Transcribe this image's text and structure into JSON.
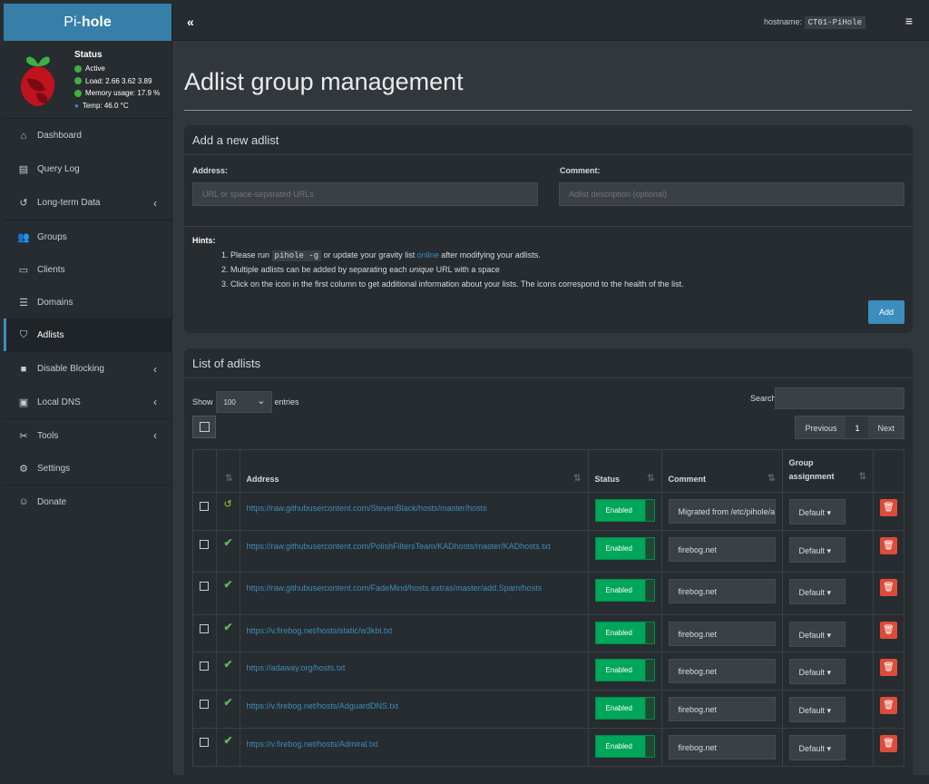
{
  "brand": {
    "prefix": "Pi-",
    "name": "hole"
  },
  "status": {
    "title": "Status",
    "active": "Active",
    "load": "Load:  2.66  3.62  3.89",
    "memory": "Memory usage:  17.9 %",
    "temp": "Temp: 46.0 °C"
  },
  "nav": [
    {
      "label": "Dashboard",
      "icon": "home-icon"
    },
    {
      "label": "Query Log",
      "icon": "file-icon"
    },
    {
      "label": "Long-term Data",
      "icon": "history-icon"
    },
    {
      "label": "Groups",
      "icon": "users-icon"
    },
    {
      "label": "Clients",
      "icon": "laptop-icon"
    },
    {
      "label": "Domains",
      "icon": "list-icon"
    },
    {
      "label": "Adlists",
      "icon": "shield-icon"
    },
    {
      "label": "Disable Blocking",
      "icon": "stop-icon"
    },
    {
      "label": "Local DNS",
      "icon": "address-book-icon"
    },
    {
      "label": "Tools",
      "icon": "tools-icon"
    },
    {
      "label": "Settings",
      "icon": "gear-icon"
    },
    {
      "label": "Donate",
      "icon": "donate-icon"
    }
  ],
  "header": {
    "collapse": "«",
    "hostname_label": "hostname:",
    "hostname": "CT01-PiHole",
    "menu": "≡"
  },
  "page": {
    "title": "Adlist group management"
  },
  "add_box": {
    "title": "Add a new adlist",
    "address_label": "Address:",
    "address_placeholder": "URL or space-separated URLs",
    "comment_label": "Comment:",
    "comment_placeholder": "Adlist description (optional)",
    "hints_label": "Hints:",
    "hint1_pre": "1. Please run ",
    "hint1_code": "pihole -g",
    "hint1_mid": " or update your gravity list ",
    "hint1_link": "online",
    "hint1_post": " after modifying your adlists.",
    "hint2_pre": "2. Multiple adlists can be added by separating each ",
    "hint2_em": "unique",
    "hint2_post": " URL with a space",
    "hint3": "3. Click on the icon in the first column to get additional information about your lists. The icons correspond to the health of the list.",
    "add_button": "Add"
  },
  "list_box": {
    "title": "List of adlists",
    "show": "Show",
    "entries_value": "100",
    "entries": "entries",
    "search": "Search:",
    "prev": "Previous",
    "page": "1",
    "next": "Next",
    "columns": {
      "address": "Address",
      "status": "Status",
      "comment": "Comment",
      "group": "Group assignment"
    },
    "rows": [
      {
        "icon": "history-icon",
        "address": "https://raw.githubusercontent.com/StevenBlack/hosts/master/hosts",
        "status": "Enabled",
        "comment": "Migrated from /etc/pihole/adlists.list",
        "group": "Default ▾"
      },
      {
        "icon": "check-icon",
        "address": "https://raw.githubusercontent.com/PolishFiltersTeam/KADhosts/master/KADhosts.txt",
        "status": "Enabled",
        "comment": "firebog.net",
        "group": "Default ▾"
      },
      {
        "icon": "check-icon",
        "address": "https://raw.githubusercontent.com/FadeMind/hosts.extras/master/add.Spam/hosts",
        "status": "Enabled",
        "comment": "firebog.net",
        "group": "Default ▾"
      },
      {
        "icon": "check-icon",
        "address": "https://v.firebog.net/hosts/static/w3kbl.txt",
        "status": "Enabled",
        "comment": "firebog.net",
        "group": "Default ▾"
      },
      {
        "icon": "check-icon",
        "address": "https://adaway.org/hosts.txt",
        "status": "Enabled",
        "comment": "firebog.net",
        "group": "Default ▾"
      },
      {
        "icon": "check-icon",
        "address": "https://v.firebog.net/hosts/AdguardDNS.txt",
        "status": "Enabled",
        "comment": "firebog.net",
        "group": "Default ▾"
      },
      {
        "icon": "check-icon",
        "address": "https://v.firebog.net/hosts/Admiral.txt",
        "status": "Enabled",
        "comment": "firebog.net",
        "group": "Default ▾"
      }
    ]
  }
}
